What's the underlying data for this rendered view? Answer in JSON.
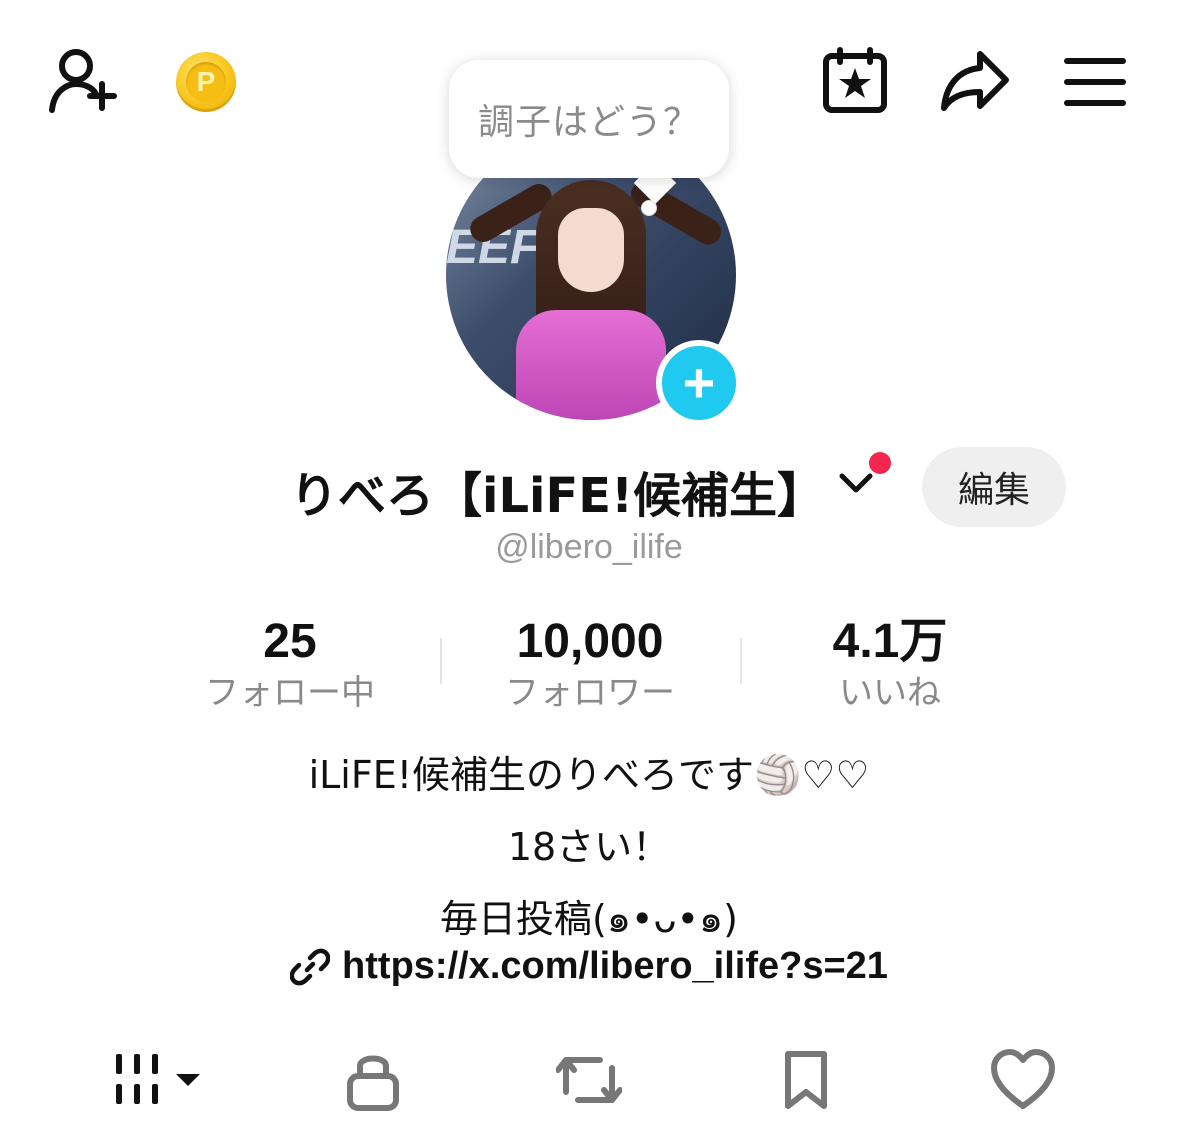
{
  "header": {
    "add_friend_icon": "person-plus-icon",
    "coin_label": "P",
    "calendar_icon": "calendar-star-icon",
    "share_icon": "share-arrow-icon",
    "menu_icon": "hamburger-menu-icon"
  },
  "status_bubble": {
    "text": "調子はどう？"
  },
  "profile": {
    "avatar_sign_text": "EEF!",
    "add_story_label": "+",
    "display_name": "りべろ【iLiFE!候補生】",
    "edit_label": "編集",
    "handle": "@libero_ilife"
  },
  "stats": [
    {
      "value": "25",
      "label": "フォロー中"
    },
    {
      "value": "10,000",
      "label": "フォロワー"
    },
    {
      "value": "4.1万",
      "label": "いいね"
    }
  ],
  "bio": {
    "line1": "iLiFE!候補生のりべろです🏐♡♡",
    "line2": "18さい！",
    "line3": "毎日投稿(๑•ᴗ•๑)",
    "link": "https://x.com/libero_ilife?s=21"
  },
  "tabs": [
    {
      "name": "videos-grid-icon"
    },
    {
      "name": "lock-icon"
    },
    {
      "name": "repost-icon"
    },
    {
      "name": "bookmark-icon"
    },
    {
      "name": "heart-icon"
    }
  ],
  "colors": {
    "accent_blue": "#20c9f0",
    "notification_red": "#f2264e",
    "coin_gold": "#f8c51c"
  }
}
